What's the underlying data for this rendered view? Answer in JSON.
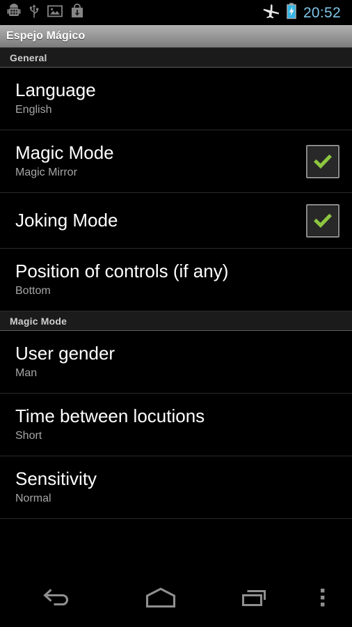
{
  "status_bar": {
    "left_icons": [
      {
        "name": "android-debug-icon",
        "label": "Android debug"
      },
      {
        "name": "usb-icon",
        "label": "USB connected"
      },
      {
        "name": "image-icon",
        "label": "Screenshot captured"
      },
      {
        "name": "download-icon",
        "label": "Download"
      }
    ],
    "right_icons": [
      {
        "name": "airplane-mode-icon",
        "label": "Airplane mode"
      },
      {
        "name": "battery-charging-icon",
        "label": "Battery charging"
      }
    ],
    "time": "20:52",
    "clock_color": "#7fc6e8",
    "battery_color": "#33b5e5"
  },
  "title_bar": {
    "title": "Espejo Mágico"
  },
  "settings": {
    "sections": [
      {
        "header": "General",
        "rows": [
          {
            "title": "Language",
            "subtitle": "English",
            "type": "preference",
            "name": "language"
          },
          {
            "title": "Magic Mode",
            "subtitle": "Magic Mirror",
            "type": "checkbox",
            "checked": true,
            "name": "magic-mode"
          },
          {
            "title": "Joking Mode",
            "subtitle": "",
            "type": "checkbox",
            "checked": true,
            "name": "joking-mode"
          },
          {
            "title": "Position of controls (if any)",
            "subtitle": "Bottom",
            "type": "preference",
            "name": "position-of-controls"
          }
        ]
      },
      {
        "header": "Magic Mode",
        "rows": [
          {
            "title": "User gender",
            "subtitle": "Man",
            "type": "preference",
            "name": "user-gender"
          },
          {
            "title": "Time between locutions",
            "subtitle": "Short",
            "type": "preference",
            "name": "time-between-locutions"
          },
          {
            "title": "Sensitivity",
            "subtitle": "Normal",
            "type": "preference",
            "name": "sensitivity"
          }
        ]
      }
    ],
    "checkbox_check_color": "#8cc63f"
  },
  "nav_bar": {
    "buttons": [
      {
        "name": "back-button",
        "label": "Back"
      },
      {
        "name": "home-button",
        "label": "Home"
      },
      {
        "name": "recents-button",
        "label": "Recent apps"
      },
      {
        "name": "overflow-menu-button",
        "label": "More options"
      }
    ],
    "icon_color": "#8f8f8f"
  }
}
